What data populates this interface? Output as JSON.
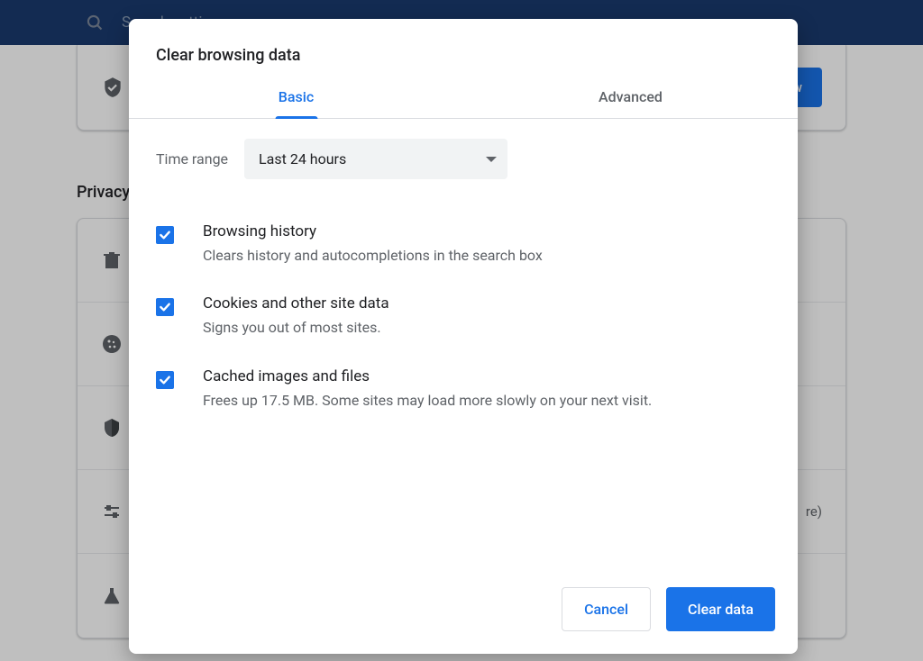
{
  "search": {
    "placeholder": "Search settings"
  },
  "background": {
    "check_now": "Check now",
    "section_title": "Privacy",
    "trailing_text": "re)"
  },
  "dialog": {
    "title": "Clear browsing data",
    "tabs": {
      "basic": "Basic",
      "advanced": "Advanced"
    },
    "time_range": {
      "label": "Time range",
      "value": "Last 24 hours"
    },
    "options": [
      {
        "title": "Browsing history",
        "desc": "Clears history and autocompletions in the search box"
      },
      {
        "title": "Cookies and other site data",
        "desc": "Signs you out of most sites."
      },
      {
        "title": "Cached images and files",
        "desc": "Frees up 17.5 MB. Some sites may load more slowly on your next visit."
      }
    ],
    "buttons": {
      "cancel": "Cancel",
      "clear": "Clear data"
    }
  }
}
